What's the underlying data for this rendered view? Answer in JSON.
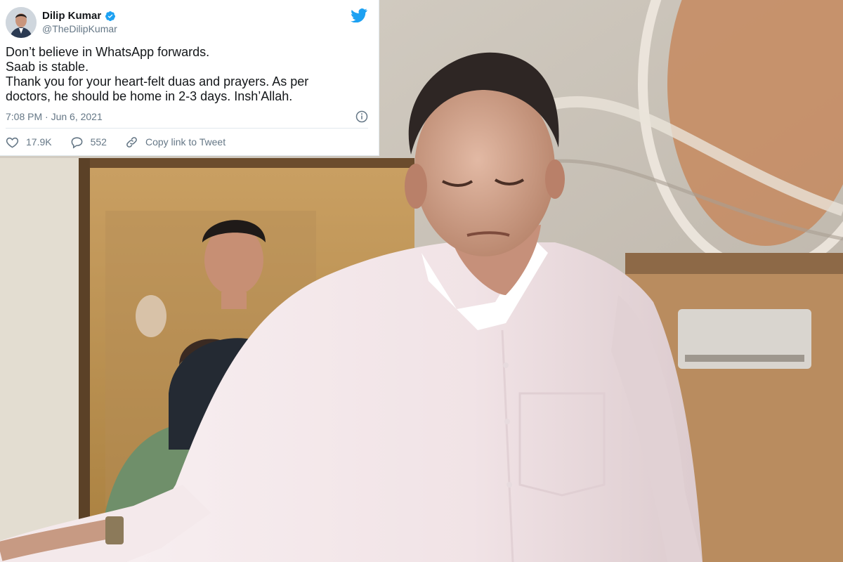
{
  "tweet": {
    "display_name": "Dilip Kumar",
    "handle": "@TheDilipKumar",
    "verified": true,
    "body_lines": [
      "Don’t believe in WhatsApp forwards.",
      "Saab is stable.",
      "Thank you for your heart-felt duas and prayers. As per",
      "doctors, he should be home in 2-3 days. Insh’Allah."
    ],
    "timestamp": "7:08 PM · Jun 6, 2021",
    "likes": "17.9K",
    "replies": "552",
    "copy_link_label": "Copy link to Tweet"
  },
  "icons": {
    "brand": "twitter-bird-icon",
    "verified": "verified-badge-icon",
    "info": "info-icon",
    "like": "heart-icon",
    "reply": "reply-bubble-icon",
    "link": "link-icon"
  },
  "colors": {
    "twitter_blue": "#1da1f2",
    "text_primary": "#14171a",
    "text_secondary": "#657786",
    "divider": "#e1e8ed",
    "wall": "#c99a56",
    "shirt": "#f3e7ea",
    "ceiling": "#c8bfb4"
  }
}
